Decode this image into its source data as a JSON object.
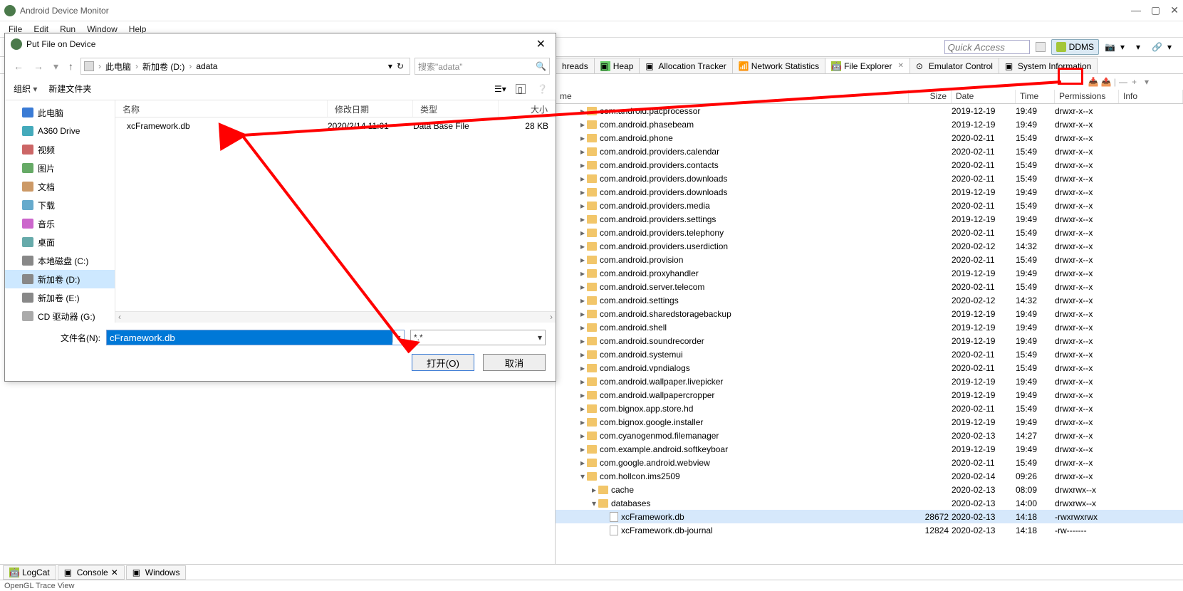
{
  "app": {
    "title": "Android Device Monitor"
  },
  "menu": {
    "file": "File",
    "edit": "Edit",
    "run": "Run",
    "window": "Window",
    "help": "Help"
  },
  "toolbar": {
    "quick_access_placeholder": "Quick Access",
    "ddms_label": "DDMS"
  },
  "tabs": {
    "threads": "hreads",
    "heap": "Heap",
    "alloc": "Allocation Tracker",
    "netstat": "Network Statistics",
    "fileexp": "File Explorer",
    "emuctl": "Emulator Control",
    "sysinfo": "System Information"
  },
  "file_table": {
    "headers": {
      "name": "me",
      "size": "Size",
      "date": "Date",
      "time": "Time",
      "perm": "Permissions",
      "info": "Info"
    },
    "rows": [
      {
        "indent": 2,
        "exp": "▸",
        "type": "folder",
        "name": "com.android.pacprocessor",
        "size": "",
        "date": "2019-12-19",
        "time": "19:49",
        "perm": "drwxr-x--x"
      },
      {
        "indent": 2,
        "exp": "▸",
        "type": "folder",
        "name": "com.android.phasebeam",
        "size": "",
        "date": "2019-12-19",
        "time": "19:49",
        "perm": "drwxr-x--x"
      },
      {
        "indent": 2,
        "exp": "▸",
        "type": "folder",
        "name": "com.android.phone",
        "size": "",
        "date": "2020-02-11",
        "time": "15:49",
        "perm": "drwxr-x--x"
      },
      {
        "indent": 2,
        "exp": "▸",
        "type": "folder",
        "name": "com.android.providers.calendar",
        "size": "",
        "date": "2020-02-11",
        "time": "15:49",
        "perm": "drwxr-x--x"
      },
      {
        "indent": 2,
        "exp": "▸",
        "type": "folder",
        "name": "com.android.providers.contacts",
        "size": "",
        "date": "2020-02-11",
        "time": "15:49",
        "perm": "drwxr-x--x"
      },
      {
        "indent": 2,
        "exp": "▸",
        "type": "folder",
        "name": "com.android.providers.downloads",
        "size": "",
        "date": "2020-02-11",
        "time": "15:49",
        "perm": "drwxr-x--x"
      },
      {
        "indent": 2,
        "exp": "▸",
        "type": "folder",
        "name": "com.android.providers.downloads",
        "size": "",
        "date": "2019-12-19",
        "time": "19:49",
        "perm": "drwxr-x--x"
      },
      {
        "indent": 2,
        "exp": "▸",
        "type": "folder",
        "name": "com.android.providers.media",
        "size": "",
        "date": "2020-02-11",
        "time": "15:49",
        "perm": "drwxr-x--x"
      },
      {
        "indent": 2,
        "exp": "▸",
        "type": "folder",
        "name": "com.android.providers.settings",
        "size": "",
        "date": "2019-12-19",
        "time": "19:49",
        "perm": "drwxr-x--x"
      },
      {
        "indent": 2,
        "exp": "▸",
        "type": "folder",
        "name": "com.android.providers.telephony",
        "size": "",
        "date": "2020-02-11",
        "time": "15:49",
        "perm": "drwxr-x--x"
      },
      {
        "indent": 2,
        "exp": "▸",
        "type": "folder",
        "name": "com.android.providers.userdiction",
        "size": "",
        "date": "2020-02-12",
        "time": "14:32",
        "perm": "drwxr-x--x"
      },
      {
        "indent": 2,
        "exp": "▸",
        "type": "folder",
        "name": "com.android.provision",
        "size": "",
        "date": "2020-02-11",
        "time": "15:49",
        "perm": "drwxr-x--x"
      },
      {
        "indent": 2,
        "exp": "▸",
        "type": "folder",
        "name": "com.android.proxyhandler",
        "size": "",
        "date": "2019-12-19",
        "time": "19:49",
        "perm": "drwxr-x--x"
      },
      {
        "indent": 2,
        "exp": "▸",
        "type": "folder",
        "name": "com.android.server.telecom",
        "size": "",
        "date": "2020-02-11",
        "time": "15:49",
        "perm": "drwxr-x--x"
      },
      {
        "indent": 2,
        "exp": "▸",
        "type": "folder",
        "name": "com.android.settings",
        "size": "",
        "date": "2020-02-12",
        "time": "14:32",
        "perm": "drwxr-x--x"
      },
      {
        "indent": 2,
        "exp": "▸",
        "type": "folder",
        "name": "com.android.sharedstoragebackup",
        "size": "",
        "date": "2019-12-19",
        "time": "19:49",
        "perm": "drwxr-x--x"
      },
      {
        "indent": 2,
        "exp": "▸",
        "type": "folder",
        "name": "com.android.shell",
        "size": "",
        "date": "2019-12-19",
        "time": "19:49",
        "perm": "drwxr-x--x"
      },
      {
        "indent": 2,
        "exp": "▸",
        "type": "folder",
        "name": "com.android.soundrecorder",
        "size": "",
        "date": "2019-12-19",
        "time": "19:49",
        "perm": "drwxr-x--x"
      },
      {
        "indent": 2,
        "exp": "▸",
        "type": "folder",
        "name": "com.android.systemui",
        "size": "",
        "date": "2020-02-11",
        "time": "15:49",
        "perm": "drwxr-x--x"
      },
      {
        "indent": 2,
        "exp": "▸",
        "type": "folder",
        "name": "com.android.vpndialogs",
        "size": "",
        "date": "2020-02-11",
        "time": "15:49",
        "perm": "drwxr-x--x"
      },
      {
        "indent": 2,
        "exp": "▸",
        "type": "folder",
        "name": "com.android.wallpaper.livepicker",
        "size": "",
        "date": "2019-12-19",
        "time": "19:49",
        "perm": "drwxr-x--x"
      },
      {
        "indent": 2,
        "exp": "▸",
        "type": "folder",
        "name": "com.android.wallpapercropper",
        "size": "",
        "date": "2019-12-19",
        "time": "19:49",
        "perm": "drwxr-x--x"
      },
      {
        "indent": 2,
        "exp": "▸",
        "type": "folder",
        "name": "com.bignox.app.store.hd",
        "size": "",
        "date": "2020-02-11",
        "time": "15:49",
        "perm": "drwxr-x--x"
      },
      {
        "indent": 2,
        "exp": "▸",
        "type": "folder",
        "name": "com.bignox.google.installer",
        "size": "",
        "date": "2019-12-19",
        "time": "19:49",
        "perm": "drwxr-x--x"
      },
      {
        "indent": 2,
        "exp": "▸",
        "type": "folder",
        "name": "com.cyanogenmod.filemanager",
        "size": "",
        "date": "2020-02-13",
        "time": "14:27",
        "perm": "drwxr-x--x"
      },
      {
        "indent": 2,
        "exp": "▸",
        "type": "folder",
        "name": "com.example.android.softkeyboar",
        "size": "",
        "date": "2019-12-19",
        "time": "19:49",
        "perm": "drwxr-x--x"
      },
      {
        "indent": 2,
        "exp": "▸",
        "type": "folder",
        "name": "com.google.android.webview",
        "size": "",
        "date": "2020-02-11",
        "time": "15:49",
        "perm": "drwxr-x--x"
      },
      {
        "indent": 2,
        "exp": "▾",
        "type": "folder",
        "name": "com.hollcon.ims2509",
        "size": "",
        "date": "2020-02-14",
        "time": "09:26",
        "perm": "drwxr-x--x"
      },
      {
        "indent": 3,
        "exp": "▸",
        "type": "folder",
        "name": "cache",
        "size": "",
        "date": "2020-02-13",
        "time": "08:09",
        "perm": "drwxrwx--x"
      },
      {
        "indent": 3,
        "exp": "▾",
        "type": "folder",
        "name": "databases",
        "size": "",
        "date": "2020-02-13",
        "time": "14:00",
        "perm": "drwxrwx--x"
      },
      {
        "indent": 4,
        "exp": " ",
        "type": "file",
        "name": "xcFramework.db",
        "size": "28672",
        "date": "2020-02-13",
        "time": "14:18",
        "perm": "-rwxrwxrwx",
        "selected": true
      },
      {
        "indent": 4,
        "exp": " ",
        "type": "file",
        "name": "xcFramework.db-journal",
        "size": "12824",
        "date": "2020-02-13",
        "time": "14:18",
        "perm": "-rw-------"
      }
    ]
  },
  "bottom_tabs": {
    "logcat": "LogCat",
    "console": "Console",
    "windows": "Windows"
  },
  "status": {
    "text": "OpenGL Trace View"
  },
  "dialog": {
    "title": "Put File on Device",
    "path": {
      "root": "此电脑",
      "p1": "新加卷 (D:)",
      "p2": "adata"
    },
    "search_placeholder": "搜索\"adata\"",
    "organize": "组织",
    "newfolder": "新建文件夹",
    "sidebar": [
      {
        "label": "此电脑",
        "icon": "pc"
      },
      {
        "label": "A360 Drive",
        "icon": "cloud"
      },
      {
        "label": "视频",
        "icon": "video"
      },
      {
        "label": "图片",
        "icon": "pic"
      },
      {
        "label": "文档",
        "icon": "doc"
      },
      {
        "label": "下载",
        "icon": "dl"
      },
      {
        "label": "音乐",
        "icon": "music"
      },
      {
        "label": "桌面",
        "icon": "desk"
      },
      {
        "label": "本地磁盘 (C:)",
        "icon": "disk"
      },
      {
        "label": "新加卷 (D:)",
        "icon": "disk",
        "selected": true
      },
      {
        "label": "新加卷 (E:)",
        "icon": "disk"
      },
      {
        "label": "CD 驱动器 (G:)",
        "icon": "cd"
      }
    ],
    "list_headers": {
      "name": "名称",
      "date": "修改日期",
      "type": "类型",
      "size": "大小"
    },
    "file": {
      "name": "xcFramework.db",
      "date": "2020/2/14 11:01",
      "type": "Data Base File",
      "size": "28 KB"
    },
    "filename_label": "文件名(N):",
    "filename_value": "cFramework.db",
    "type_filter": "*.*",
    "btn_open": "打开(O)",
    "btn_cancel": "取消"
  }
}
